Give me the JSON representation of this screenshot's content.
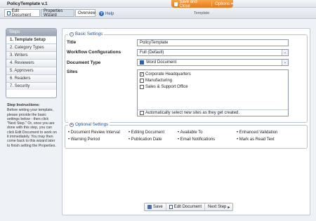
{
  "app": {
    "title": "PolicyTemplate v.1"
  },
  "top_actions": {
    "save_close": "Save and Close",
    "options": "Options",
    "options_arrow": "▾"
  },
  "toolbar": {
    "tabs": [
      {
        "label": "Edit Document"
      },
      {
        "label": "Properties Wizard"
      },
      {
        "label": "Overview"
      }
    ],
    "help": "Help",
    "template_label": "Template"
  },
  "steps": {
    "header": "Steps",
    "items": [
      {
        "label": "1. Template Setup"
      },
      {
        "label": "2. Category Types"
      },
      {
        "label": "3. Writers"
      },
      {
        "label": "4. Reviewers"
      },
      {
        "label": "5. Approvers"
      },
      {
        "label": "6. Readers"
      },
      {
        "label": "7. Security"
      }
    ],
    "active_index": 0
  },
  "instructions": {
    "title": "Step Instructions:",
    "text": "Before writing your template, please provide the basic settings below - then click \"Next Step.\" Or, once you are done with this step, you can click Edit Document to work on it immediately. You may then come back to this wizard later to finish setting the Properties."
  },
  "basic": {
    "legend": "Basic Settings",
    "toggle": "−",
    "title_label": "Title",
    "title_value": "PolicyTemplate",
    "workflow_label": "Workflow Configurations",
    "workflow_value": "Full (Default)",
    "doctype_label": "Document Type",
    "doctype_value": "Word Document",
    "sites_label": "Sites",
    "sites": [
      {
        "label": "Corporate Headquarters",
        "checked": true
      },
      {
        "label": "Manufacturing",
        "checked": false
      },
      {
        "label": "Sales & Support Office",
        "checked": false
      }
    ],
    "auto_select_label": "Automatically select new sites as they get created."
  },
  "optional": {
    "legend": "Optional Settings",
    "toggle": "+",
    "columns": [
      [
        "Document Review Interval",
        "Warning Period"
      ],
      [
        "Editing Document",
        "Publication Date"
      ],
      [
        "Available To",
        "Email Notifications"
      ],
      [
        "Enhanced Validation",
        "Mark as Read Text"
      ]
    ]
  },
  "bottom": {
    "save": "Save",
    "edit": "Edit Document",
    "next": "Next Step",
    "next_arrow": "▸"
  },
  "colors": {
    "accent_orange": "#e3781b",
    "link_blue": "#1f4f8c",
    "panel_grey": "#9aa4b2"
  }
}
